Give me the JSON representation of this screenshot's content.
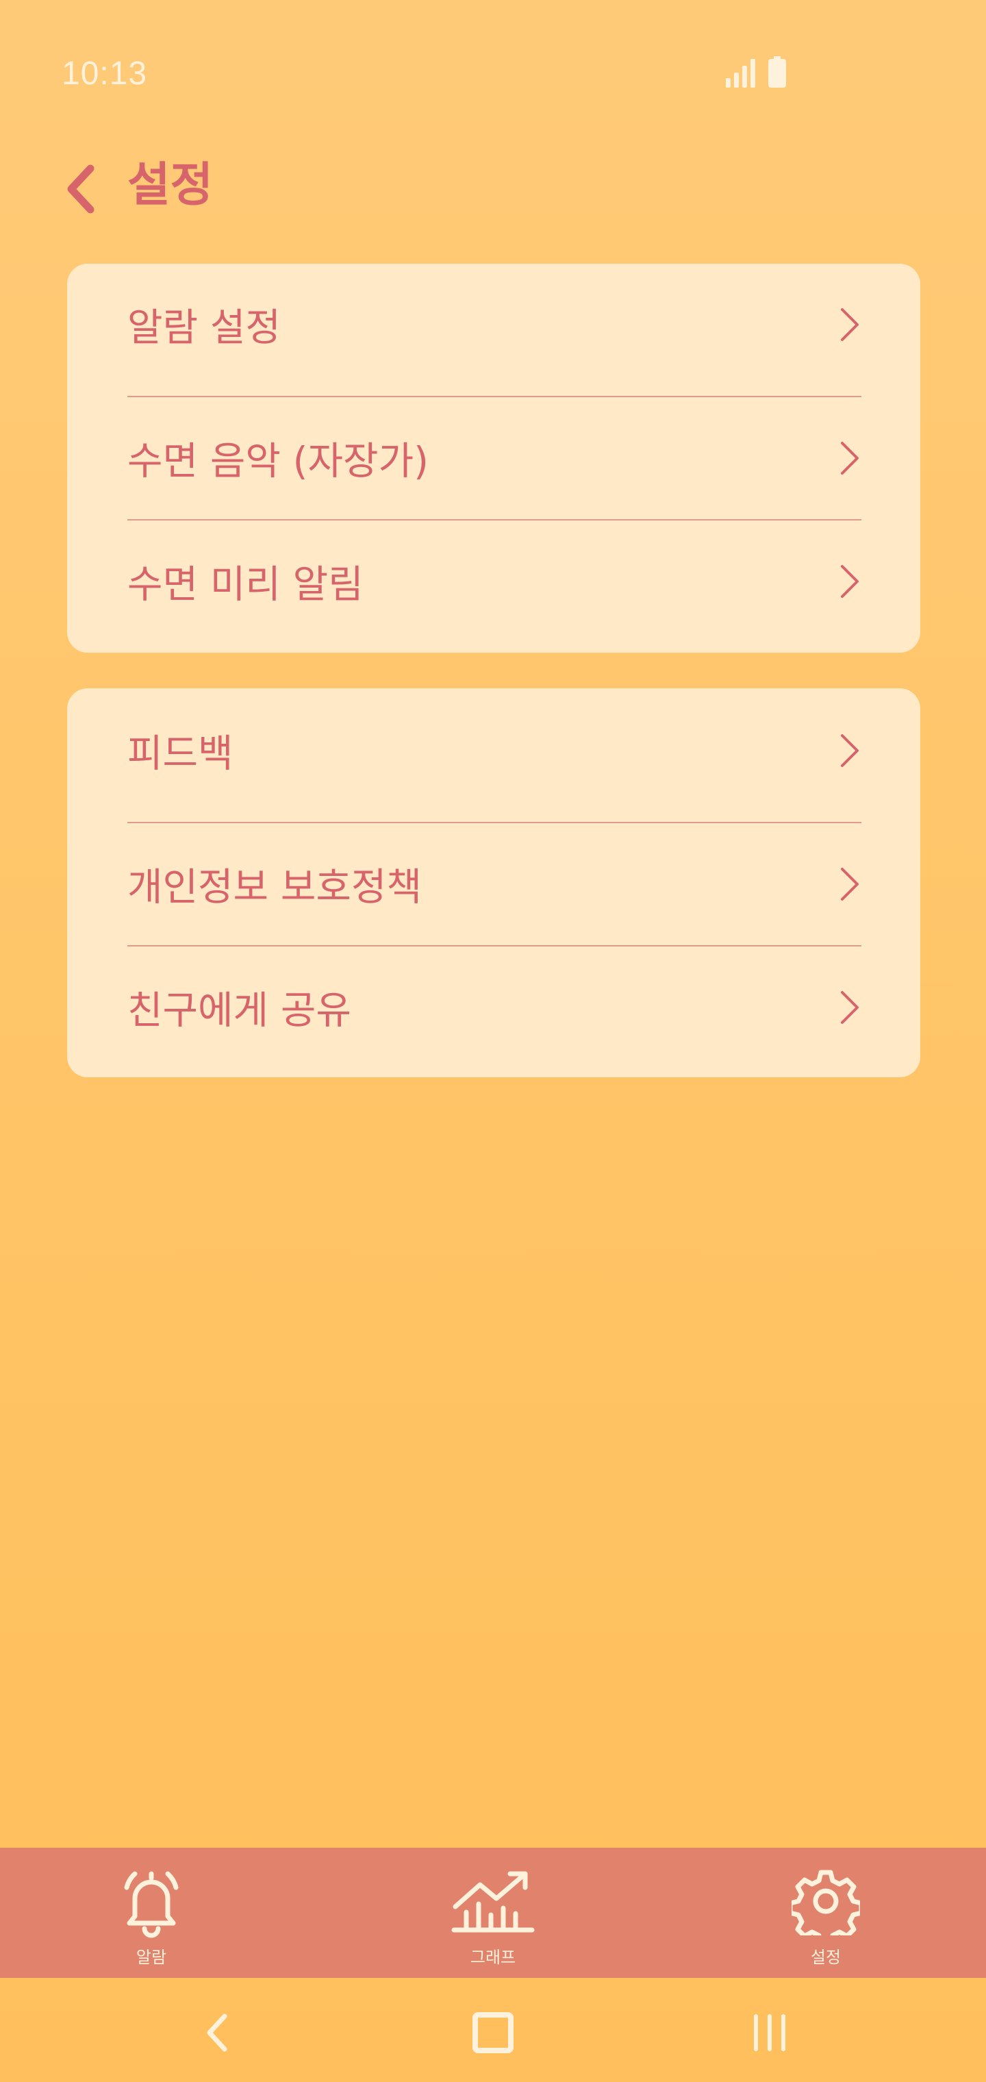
{
  "status_bar": {
    "time": "10:13",
    "icons": [
      "signal-icon",
      "battery-icon"
    ]
  },
  "header": {
    "back_icon": "chevron-left-icon",
    "title": "설정"
  },
  "groups": [
    {
      "items": [
        {
          "label": "알람 설정",
          "icon": "chevron-right-icon"
        },
        {
          "label": "수면 음악 (자장가)",
          "icon": "chevron-right-icon"
        },
        {
          "label": "수면 미리 알림",
          "icon": "chevron-right-icon"
        }
      ]
    },
    {
      "items": [
        {
          "label": "피드백",
          "icon": "chevron-right-icon"
        },
        {
          "label": "개인정보 보호정책",
          "icon": "chevron-right-icon"
        },
        {
          "label": "친구에게 공유",
          "icon": "chevron-right-icon"
        }
      ]
    }
  ],
  "bottom_nav": {
    "items": [
      {
        "label": "알람",
        "icon": "bell-icon"
      },
      {
        "label": "그래프",
        "icon": "graph-icon"
      },
      {
        "label": "설정",
        "icon": "gear-icon"
      }
    ]
  },
  "system_nav": {
    "icons": [
      "back-icon",
      "home-icon",
      "recent-apps-icon"
    ]
  },
  "colors": {
    "background": "#ffc466",
    "card": "#ffe9c6",
    "accent": "#d6646a",
    "nav_bar": "#e0826c",
    "light_text": "#fff2dc"
  }
}
